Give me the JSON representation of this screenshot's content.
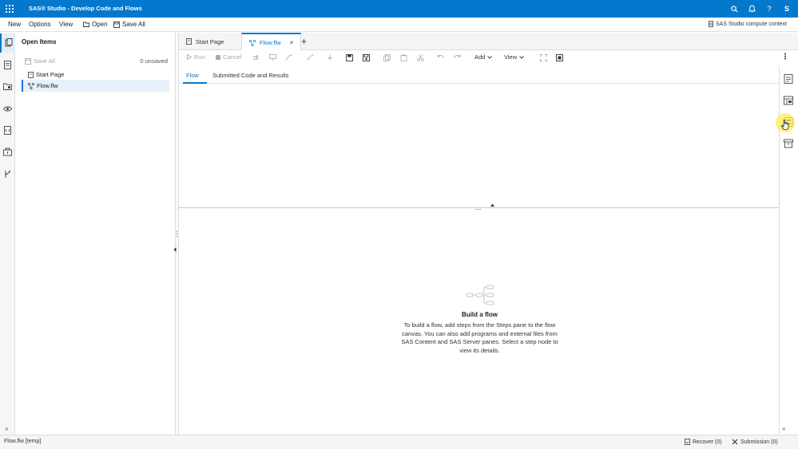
{
  "titlebar": {
    "title": "SAS® Studio - Develop Code and Flows",
    "avatar": "S",
    "icons": [
      "grid-icon",
      "search-icon",
      "bell-icon",
      "help-icon"
    ],
    "help_glyph": "?"
  },
  "menubar": {
    "new": "New",
    "options": "Options",
    "view": "View",
    "open": "Open",
    "save_all": "Save All",
    "context": "SAS Studio compute context"
  },
  "open_items": {
    "header": "Open Items",
    "save_all": "Save All",
    "unsaved": "0 unsaved",
    "items": [
      {
        "label": "Start Page",
        "icon": "page-icon"
      },
      {
        "label": "Flow.flw",
        "icon": "flow-icon",
        "selected": true
      }
    ]
  },
  "tabs": [
    {
      "label": "Start Page",
      "icon": "page-icon"
    },
    {
      "label": "Flow.flw",
      "icon": "flow-icon",
      "active": true,
      "close": "×"
    }
  ],
  "add_tab": "+",
  "toolbar": {
    "run": "Run",
    "cancel": "Cancel",
    "add": "Add",
    "view": "View"
  },
  "subtabs": [
    {
      "label": "Flow",
      "active": true
    },
    {
      "label": "Submitted Code and Results"
    }
  ],
  "splitter_dots": "....",
  "empty_state": {
    "title": "Build a flow",
    "body": "To build a flow, add steps from the Steps pane to the flow canvas. You can also add programs and external files from SAS Content and SAS Server panes. Select a step node to view its details."
  },
  "statusbar": {
    "file": "Flow.flw [temp]",
    "recover": "Recover (0)",
    "submission": "Submission (0)"
  },
  "colors": {
    "accent": "#0378cd",
    "titlebar": "#0378cd",
    "cursor_highlight": "#ffee50"
  },
  "chevrons": {
    "expand": "»",
    "collapse": "«"
  }
}
